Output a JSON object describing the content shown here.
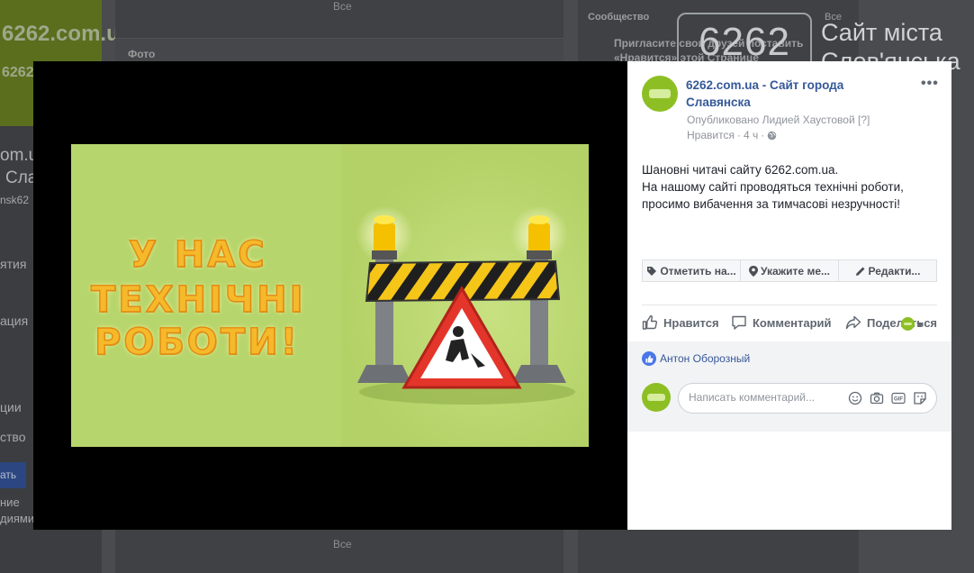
{
  "background": {
    "left": {
      "logo_text": "6262.com.ua",
      "logo_sub": "6262",
      "name_line1": "om.ua",
      "name_line2": "Сла",
      "username": "nsk62",
      "items": [
        "ятия",
        "ация",
        "ции",
        "ство"
      ],
      "button_label": "ать",
      "footer_line1": "ние",
      "footer_line2": "диями"
    },
    "center": {
      "top_all": "Все",
      "photo_header": "Фото",
      "bottom_all": "Все"
    },
    "right": {
      "community_title": "Сообщество",
      "community_all": "Все",
      "invite_line1": "Пригласите свои друзей поставить",
      "invite_line2": "«Нравится» этой Странице"
    },
    "watermark": {
      "number": "6262",
      "line1": "Сайт міста",
      "line2": "Слов'янська"
    }
  },
  "modal": {
    "photo": {
      "line1": "У НАС",
      "line2": "ТЕХНІЧНІ",
      "line3": "РОБОТИ!"
    },
    "post": {
      "page_name": "6262.com.ua - Сайт города Славянска",
      "published_by": "Опубликовано Лидией Хаустовой",
      "help_mark": "[?]",
      "like_label": "Нравится",
      "time": "4 ч",
      "text_lines": [
        "Шановні читачі сайту 6262.com.ua.",
        "На нашому сайті проводяться технічні роботи,",
        "просимо вибачення за тимчасові незручності!"
      ],
      "tag_buttons": [
        "Отметить на...",
        "Укажите ме...",
        "Редакти..."
      ],
      "actions": {
        "like": "Нравится",
        "comment": "Комментарий",
        "share": "Поделиться"
      },
      "liked_by": "Антон Оборозный",
      "comment_placeholder": "Написать комментарий...",
      "more_icon": "more-dots-icon"
    }
  },
  "colors": {
    "link": "#365899",
    "brand_green": "#8dbf24",
    "photo_bg": "#b6d56c",
    "text": "#1d2129",
    "meta": "#90949c"
  }
}
